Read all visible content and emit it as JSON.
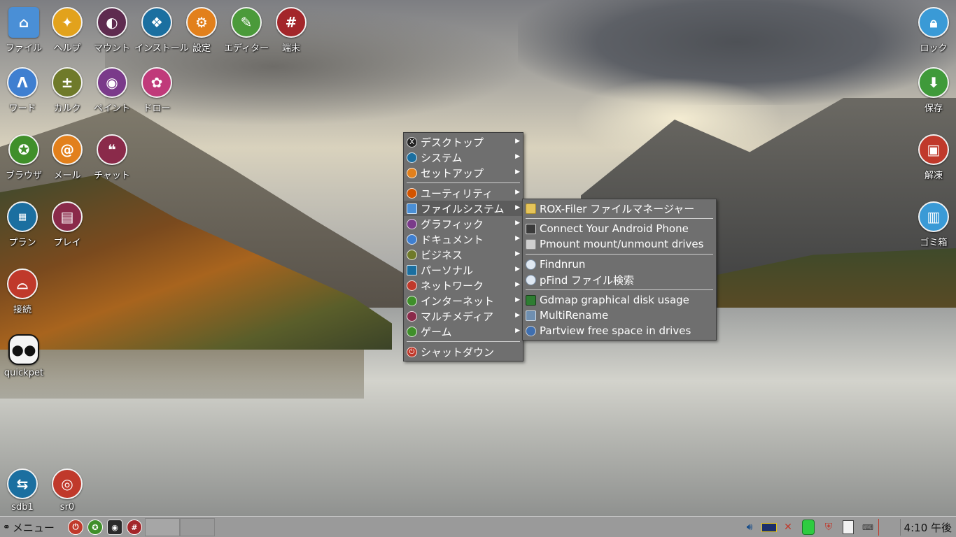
{
  "desktop_icons_left": [
    {
      "label": "ファイル",
      "icon": "home-folder-icon",
      "color": "#4a8fd6"
    },
    {
      "label": "ヘルプ",
      "icon": "lightbulb-icon",
      "color": "#e2a21c"
    },
    {
      "label": "マウント",
      "icon": "toggle-icon",
      "color": "#5e2b4f"
    },
    {
      "label": "インストール",
      "icon": "dropbox-icon",
      "color": "#1b6fa0"
    },
    {
      "label": "設定",
      "icon": "gear-icon",
      "color": "#e2801c"
    },
    {
      "label": "エディター",
      "icon": "edit-icon",
      "color": "#4b9a3a"
    },
    {
      "label": "端末",
      "icon": "terminal-icon",
      "color": "#a3262a"
    },
    {
      "label": "ワード",
      "icon": "word-icon",
      "color": "#3f7fd0"
    },
    {
      "label": "カルク",
      "icon": "calculator-icon",
      "color": "#6f7a2a"
    },
    {
      "label": "ペイント",
      "icon": "palette-icon",
      "color": "#7a3a8a"
    },
    {
      "label": "ドロー",
      "icon": "draw-icon",
      "color": "#c03a7a"
    },
    {
      "label": "ブラウザ",
      "icon": "browser-icon",
      "color": "#3f8f2a"
    },
    {
      "label": "メール",
      "icon": "mail-icon",
      "color": "#e2801c"
    },
    {
      "label": "チャット",
      "icon": "chat-icon",
      "color": "#8a2a4a"
    },
    {
      "label": "プラン",
      "icon": "calendar-icon",
      "color": "#1b6fa0"
    },
    {
      "label": "プレイ",
      "icon": "media-icon",
      "color": "#8a2a4a"
    },
    {
      "label": "接続",
      "icon": "satellite-icon",
      "color": "#c0392b"
    },
    {
      "label": "quickpet",
      "icon": "panda-icon",
      "color": "#111111"
    },
    {
      "label": "sdb1",
      "icon": "usb-drive-icon",
      "color": "#1b6fa0"
    },
    {
      "label": "sr0",
      "icon": "optical-drive-icon",
      "color": "#c0392b"
    }
  ],
  "desktop_icons_right": [
    {
      "label": "ロック",
      "icon": "lock-icon",
      "color": "#3a9ad6"
    },
    {
      "label": "保存",
      "icon": "download-icon",
      "color": "#3f9a3a"
    },
    {
      "label": "解凍",
      "icon": "unpack-icon",
      "color": "#c0392b"
    },
    {
      "label": "ゴミ箱",
      "icon": "trash-icon",
      "color": "#3a9ad6"
    }
  ],
  "main_menu": [
    {
      "label": "デスクトップ",
      "has_submenu": true,
      "icon_color": "#222222"
    },
    {
      "label": "システム",
      "has_submenu": true,
      "icon_color": "#1b6fa0"
    },
    {
      "label": "セットアップ",
      "has_submenu": true,
      "icon_color": "#e2801c"
    },
    {
      "label": "ユーティリティ",
      "has_submenu": true,
      "icon_color": "#d35400"
    },
    {
      "label": "ファイルシステム",
      "has_submenu": true,
      "icon_color": "#4a8fd6",
      "active": true
    },
    {
      "label": "グラフィック",
      "has_submenu": true,
      "icon_color": "#7a3a8a"
    },
    {
      "label": "ドキュメント",
      "has_submenu": true,
      "icon_color": "#3f7fd0"
    },
    {
      "label": "ビジネス",
      "has_submenu": true,
      "icon_color": "#6f7a2a"
    },
    {
      "label": "パーソナル",
      "has_submenu": true,
      "icon_color": "#1b6fa0"
    },
    {
      "label": "ネットワーク",
      "has_submenu": true,
      "icon_color": "#c0392b"
    },
    {
      "label": "インターネット",
      "has_submenu": true,
      "icon_color": "#3f8f2a"
    },
    {
      "label": "マルチメディア",
      "has_submenu": true,
      "icon_color": "#8a2a4a"
    },
    {
      "label": "ゲーム",
      "has_submenu": true,
      "icon_color": "#3f8f2a"
    },
    {
      "label": "シャットダウン",
      "has_submenu": false,
      "icon_color": "#c0392b"
    }
  ],
  "filesystem_submenu": [
    {
      "label": "ROX-Filer ファイルマネージャー"
    },
    {
      "label": "Connect Your Android Phone"
    },
    {
      "label": "Pmount mount/unmount drives"
    },
    {
      "label": "Findnrun"
    },
    {
      "label": "pFind ファイル検索"
    },
    {
      "label": "Gdmap graphical disk usage"
    },
    {
      "label": "MultiRename"
    },
    {
      "label": "Partview free space in drives"
    }
  ],
  "taskbar": {
    "menu_label": "メニュー",
    "clock": "4:10 午後"
  }
}
